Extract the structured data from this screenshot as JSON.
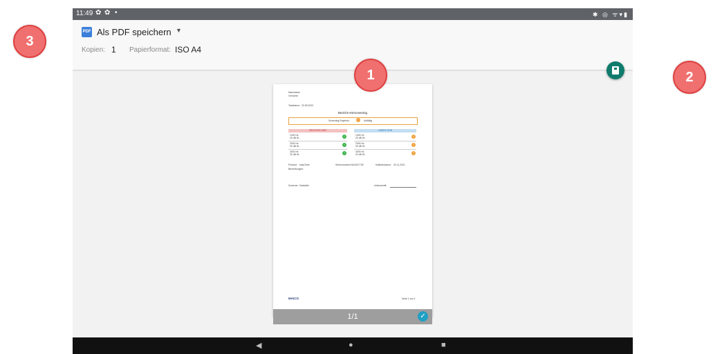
{
  "status_bar": {
    "time": "11:49",
    "right_icons": "✱ ◎ ᯤ▾▮"
  },
  "toolbar": {
    "printer_name": "Als PDF speichern",
    "pdf_icon_text": "PDF",
    "dropdown_glyph": "▼",
    "copies_label": "Kopien:",
    "copies_value": "1",
    "paper_label": "Papierformat:",
    "paper_value": "ISO A4",
    "save_icon": "save-pdf-icon"
  },
  "preview": {
    "report_title": "Bericht Hörscreening",
    "nachname_label": "Nachname:",
    "vorname_label": "Vorname:",
    "testdatum_label": "Testdatum:",
    "testdatum_value": "23.05.2020",
    "result_label": "Screening Ergebnis:",
    "result_value": "Auffällig",
    "right_ear_header": "RECHTES OHR",
    "left_ear_header": "LINKES OHR",
    "right_rows": [
      {
        "hz": "1000 Hz",
        "db": "20 dB HL",
        "status": "ok"
      },
      {
        "hz": "2000 Hz",
        "db": "20 dB HL",
        "status": "ok"
      },
      {
        "hz": "4000 Hz",
        "db": "20 dB HL",
        "status": "ok"
      }
    ],
    "left_rows": [
      {
        "hz": "1000 Hz",
        "db": "20 dB HL",
        "status": "warn"
      },
      {
        "hz": "2000 Hz",
        "db": "20 dB HL",
        "status": "warn"
      },
      {
        "hz": "4000 Hz",
        "db": "20 dB HL",
        "status": "warn"
      }
    ],
    "product_label": "Produkt:",
    "product_value": "easyTone",
    "serial_label": "Seriennummer:",
    "serial_value": "N0100772E",
    "calib_label": "Kalibrierdatum:",
    "calib_value": "02.11.2021",
    "remarks_label": "Bemerkungen:",
    "tester_label": "Screener:",
    "tester_value": "Gestaltet",
    "signature_label": "Unterschrift:",
    "logo": "MAICO",
    "page_footer": "Seite 1 von 1"
  },
  "page_indicator": "1/1",
  "badges": [
    "1",
    "2",
    "3"
  ]
}
